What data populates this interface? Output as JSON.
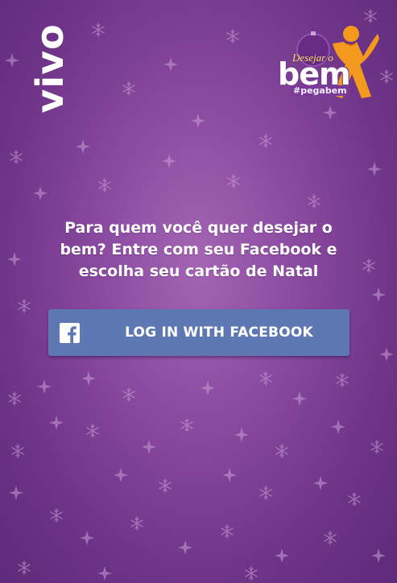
{
  "brand": {
    "logo_text": "vivo"
  },
  "campaign": {
    "top_text": "Desejar o",
    "main_text": "bem",
    "hashtag": "#pegabem"
  },
  "message": {
    "text": "Para quem você quer desejar o bem? Entre com seu Facebook e escolha seu cartão de Natal"
  },
  "login": {
    "button_label": "LOG IN WITH FACEBOOK",
    "icon": "facebook-icon"
  },
  "colors": {
    "background": "#8a4aa0",
    "button": "#5d78b3",
    "text": "#ffffff"
  }
}
